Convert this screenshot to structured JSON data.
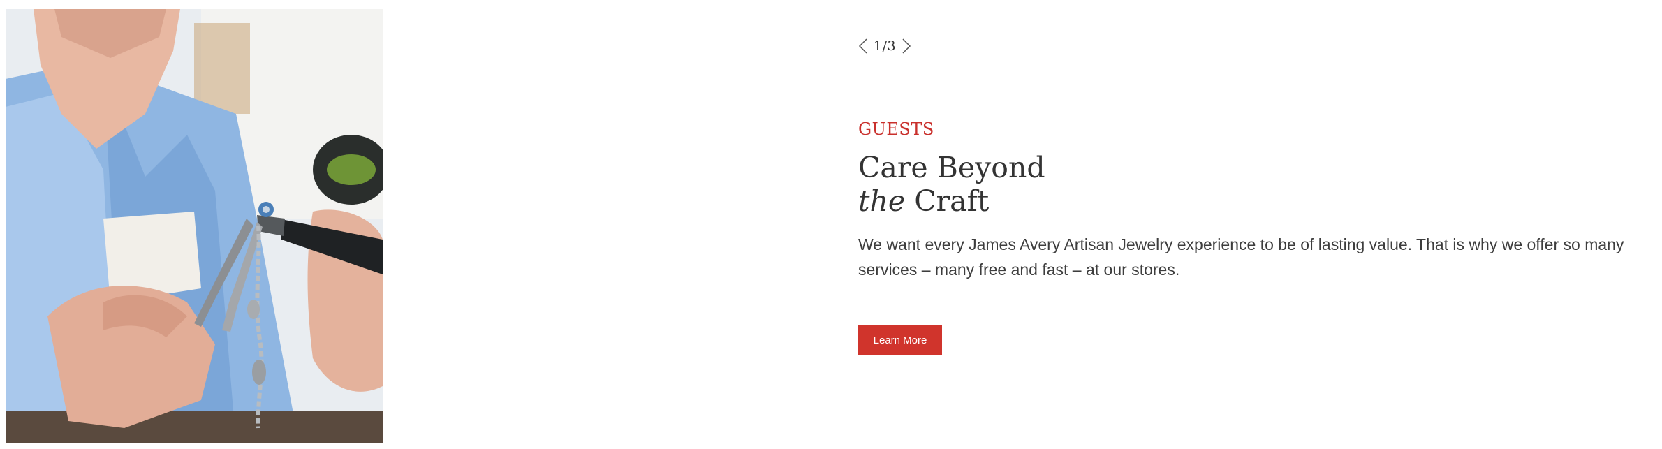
{
  "slider": {
    "counter": "1/3",
    "prev_icon": "chevron-left-icon",
    "next_icon": "chevron-right-icon"
  },
  "content": {
    "eyebrow": "GUESTS",
    "headline_line1": "Care Beyond",
    "headline_italic": "the",
    "headline_rest": " Craft",
    "body": "We want every James Avery Artisan Jewelry experience to be of lasting value. That is why we offer so many services – many free and fast – at our stores.",
    "cta_label": "Learn More"
  },
  "colors": {
    "accent": "#d0342c",
    "eyebrow": "#c9302c",
    "text": "#333333"
  }
}
